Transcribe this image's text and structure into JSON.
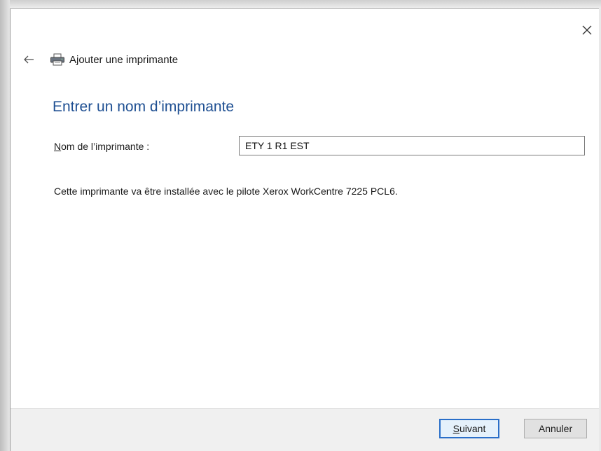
{
  "window": {
    "title": "Ajouter une imprimante",
    "close_label": "×"
  },
  "main": {
    "heading": "Entrer un nom d’imprimante",
    "name_label_accel": "N",
    "name_label_rest": "om de l’imprimante :",
    "name_value": "ETY 1 R1 EST",
    "info": "Cette imprimante va être installée avec le pilote Xerox WorkCentre 7225 PCL6."
  },
  "footer": {
    "next_accel": "S",
    "next_rest": "uivant",
    "cancel_label": "Annuler"
  },
  "icons": {
    "back": "back-arrow-icon",
    "printer": "printer-icon",
    "close": "close-icon"
  },
  "colors": {
    "heading": "#1e4f92",
    "default_button_border": "#2a6fc9"
  }
}
